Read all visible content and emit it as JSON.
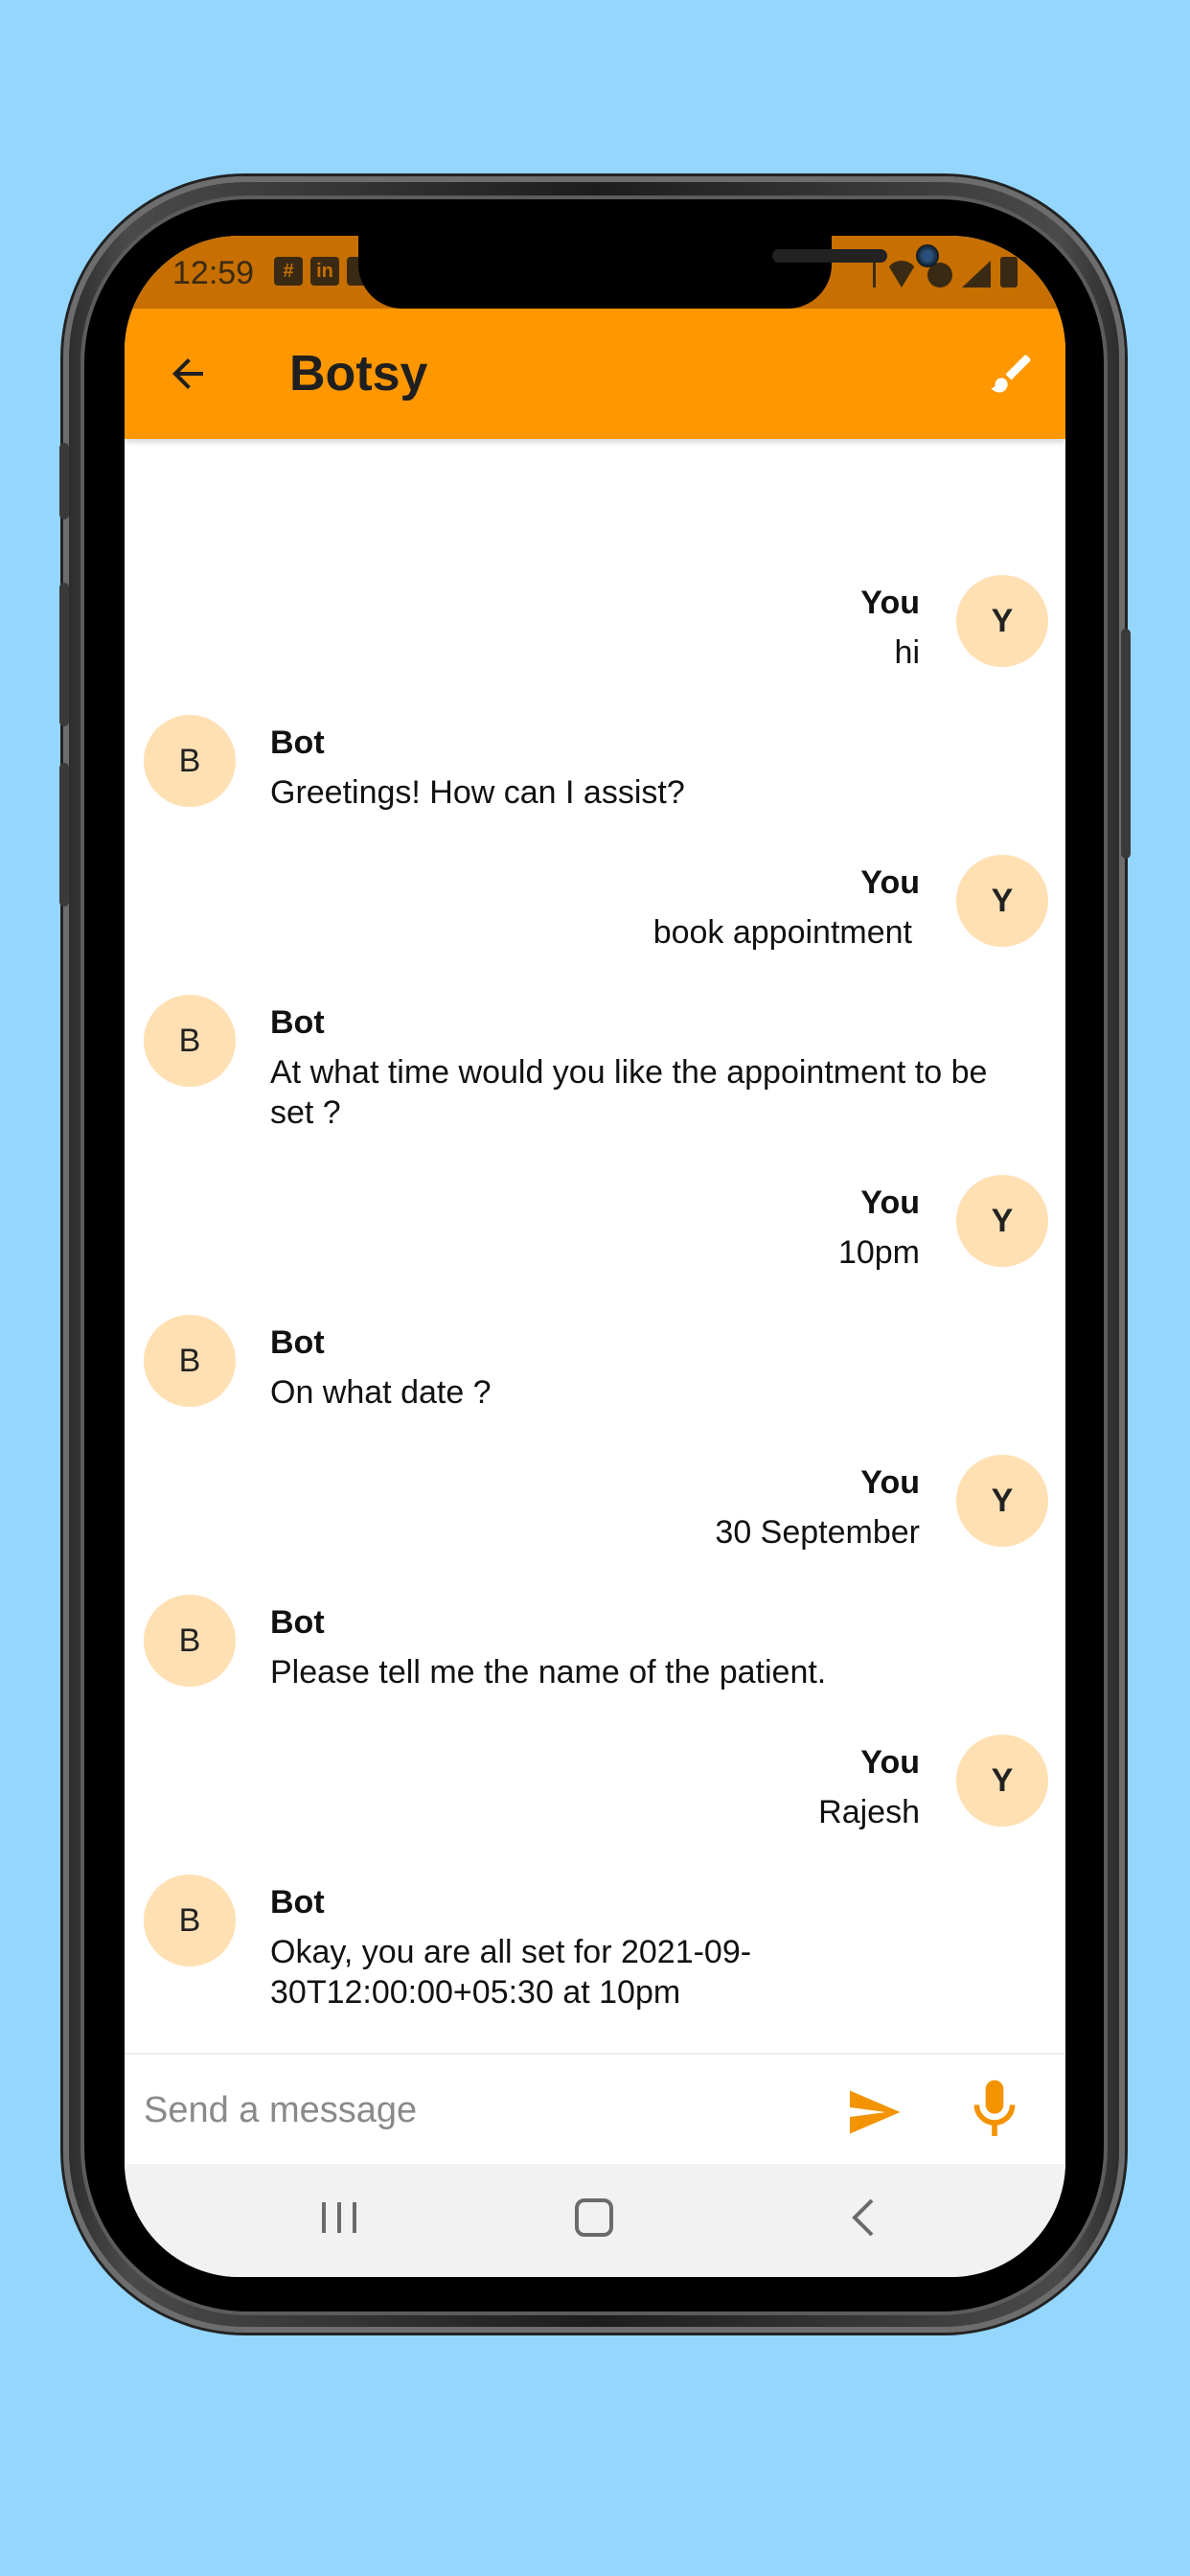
{
  "status_bar": {
    "time": "12:59",
    "notification_icons": [
      "slack-icon",
      "linkedin-icon",
      "image-icon"
    ],
    "system_icons": [
      "bluetooth-icon",
      "wifi-icon",
      "call-icon",
      "signal-icon",
      "battery-icon"
    ]
  },
  "app_bar": {
    "title": "Botsy",
    "back_icon": "arrow-left-icon",
    "action_icon": "brush-icon"
  },
  "messages": [
    {
      "sender": "You",
      "avatar": "Y",
      "text": "hi"
    },
    {
      "sender": "Bot",
      "avatar": "B",
      "text": "Greetings! How can I assist?"
    },
    {
      "sender": "You",
      "avatar": "Y",
      "text": "book appointment"
    },
    {
      "sender": "Bot",
      "avatar": "B",
      "text": "At what time would you like the appointment to be set ?"
    },
    {
      "sender": "You",
      "avatar": "Y",
      "text": "10pm"
    },
    {
      "sender": "Bot",
      "avatar": "B",
      "text": "On what date ?"
    },
    {
      "sender": "You",
      "avatar": "Y",
      "text": "30 September"
    },
    {
      "sender": "Bot",
      "avatar": "B",
      "text": "Please tell me the name of the patient."
    },
    {
      "sender": "You",
      "avatar": "Y",
      "text": "Rajesh"
    },
    {
      "sender": "Bot",
      "avatar": "B",
      "text": "Okay, you are all set for 2021-09-30T12:00:00+05:30 at 10pm"
    }
  ],
  "composer": {
    "placeholder": "Send a message",
    "value": "",
    "send_icon": "send-icon",
    "mic_icon": "mic-icon"
  },
  "nav_bar": {
    "buttons": [
      "recent-apps-icon",
      "home-icon",
      "back-icon"
    ]
  },
  "colors": {
    "app_bar": "#ff9700",
    "status_bar": "#c76f00",
    "avatar_bg": "#ffe0b3",
    "accent": "#f39300",
    "page_bg": "#94d6fe"
  }
}
